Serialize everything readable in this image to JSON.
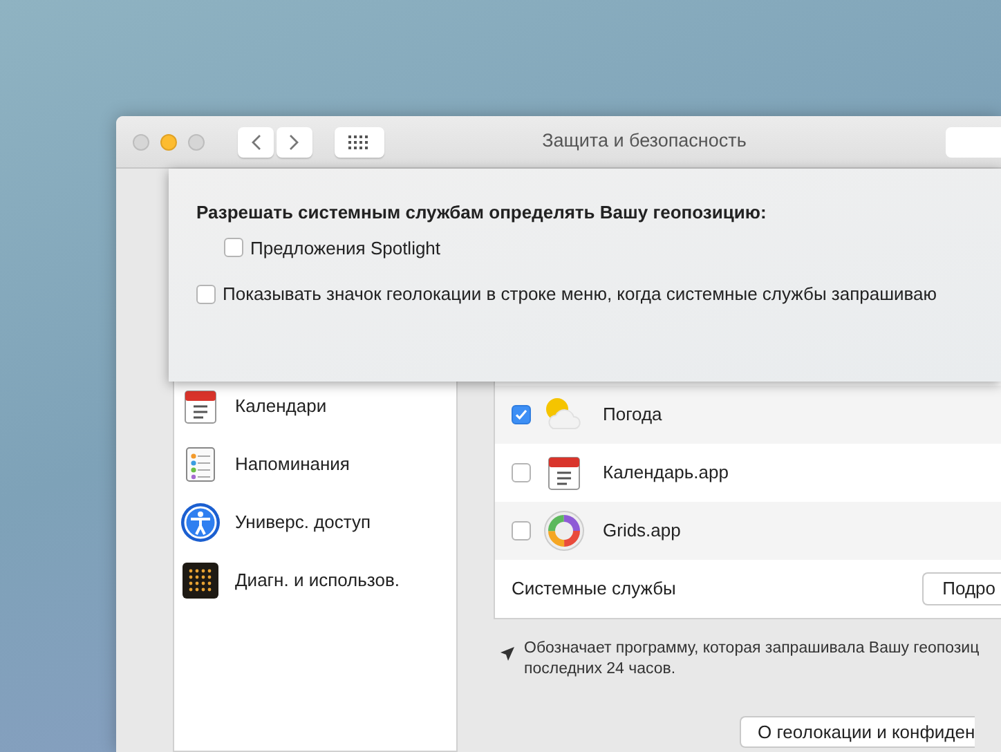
{
  "window": {
    "title": "Защита и безопасность"
  },
  "sheet": {
    "heading": "Разрешать системным службам определять Вашу геопозицию:",
    "options": [
      {
        "label": "Предложения Spotlight",
        "checked": false,
        "kind": "indented"
      },
      {
        "label": "Показывать значок геолокации в строке меню, когда системные службы запрашиваю",
        "checked": false,
        "kind": "plain"
      }
    ]
  },
  "sidebar": {
    "items": [
      {
        "label": "Календари"
      },
      {
        "label": "Напоминания"
      },
      {
        "label": "Универс. доступ"
      },
      {
        "label": "Диагн. и использов."
      }
    ]
  },
  "apps": [
    {
      "name": "Погода",
      "checked": true
    },
    {
      "name": "Календарь.app",
      "checked": false
    },
    {
      "name": "Grids.app",
      "checked": false
    }
  ],
  "system_services": {
    "label": "Системные службы",
    "button": "Подро"
  },
  "note": {
    "lines": [
      "Обозначает программу, которая запрашивала Вашу геопозиц",
      "последних 24 часов."
    ]
  },
  "about_button": "О геолокации и конфиден"
}
